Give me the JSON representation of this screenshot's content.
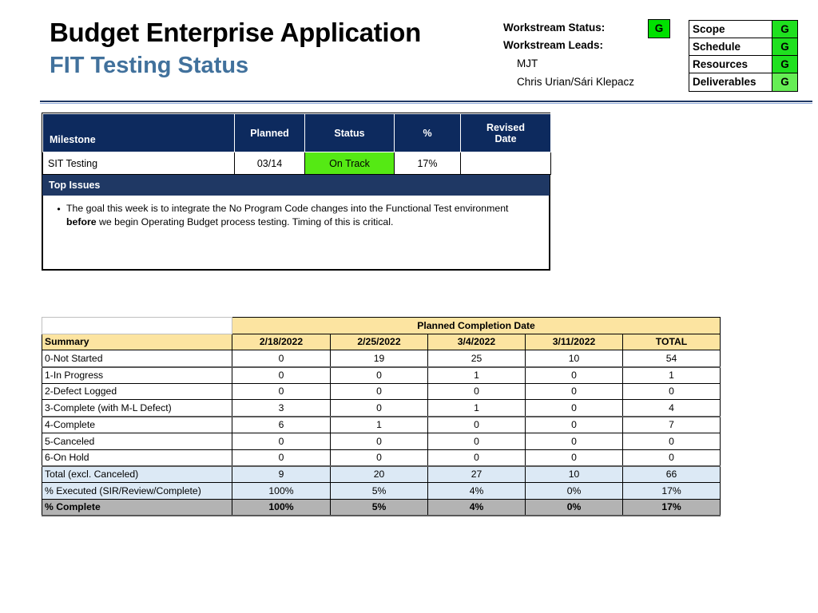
{
  "header": {
    "main_title": "Budget Enterprise Application",
    "sub_title": "FIT Testing Status",
    "workstream_status_label": "Workstream Status:",
    "workstream_status_value": "G",
    "workstream_leads_label": "Workstream Leads:",
    "lead_1": "MJT",
    "lead_2": "Chris Urian/Sári Klepacz",
    "accent_color": "#41719C",
    "status_green": "#00E000"
  },
  "rag": {
    "rows": [
      {
        "label": "Scope",
        "value": "G",
        "color": "#1FE01F"
      },
      {
        "label": "Schedule",
        "value": "G",
        "color": "#1FE01F"
      },
      {
        "label": "Resources",
        "value": "G",
        "color": "#1FE01F"
      },
      {
        "label": "Deliverables",
        "value": "G",
        "color": "#66EE55"
      }
    ]
  },
  "milestone": {
    "headers": [
      "Milestone",
      "Planned",
      "Status",
      "%",
      "Revised Date"
    ],
    "header_revised_line1": "Revised",
    "header_revised_line2": "Date",
    "rows": [
      {
        "milestone": "SIT Testing",
        "planned": "03/14",
        "status": "On Track",
        "percent": "17%",
        "revised_date": "",
        "status_color": "#55E914"
      }
    ],
    "top_issues_title": "Top Issues",
    "issues": [
      {
        "bullet": "•",
        "text_before": "The goal this week is to integrate the No Program Code changes into the Functional Test environment ",
        "text_bold": "before",
        "text_after": " we begin Operating Budget process testing.  Timing of this is critical."
      }
    ]
  },
  "summary": {
    "group_header": "Planned Completion Date",
    "row_label_header": "Summary",
    "columns": [
      "2/18/2022",
      "2/25/2022",
      "3/4/2022",
      "3/11/2022",
      "TOTAL"
    ],
    "rows": [
      {
        "label": "0-Not Started",
        "values": [
          "0",
          "19",
          "25",
          "10",
          "54"
        ],
        "style": "row-white"
      },
      {
        "label": "1-In Progress",
        "values": [
          "0",
          "0",
          "1",
          "0",
          "1"
        ],
        "style": "row-white"
      },
      {
        "label": "2-Defect Logged",
        "values": [
          "0",
          "0",
          "0",
          "0",
          "0"
        ],
        "style": "row-white"
      },
      {
        "label": "3-Complete (with M-L Defect)",
        "values": [
          "3",
          "0",
          "1",
          "0",
          "4"
        ],
        "style": "row-white"
      },
      {
        "label": "4-Complete",
        "values": [
          "6",
          "1",
          "0",
          "0",
          "7"
        ],
        "style": "row-white"
      },
      {
        "label": "5-Canceled",
        "values": [
          "0",
          "0",
          "0",
          "0",
          "0"
        ],
        "style": "row-white"
      },
      {
        "label": "6-On Hold",
        "values": [
          "0",
          "0",
          "0",
          "0",
          "0"
        ],
        "style": "row-white"
      },
      {
        "label": "Total (excl. Canceled)",
        "values": [
          "9",
          "20",
          "27",
          "10",
          "66"
        ],
        "style": "row-blue"
      },
      {
        "label": "% Executed (SIR/Review/Complete)",
        "values": [
          "100%",
          "5%",
          "4%",
          "0%",
          "17%"
        ],
        "style": "row-blue"
      },
      {
        "label": "% Complete",
        "values": [
          "100%",
          "5%",
          "4%",
          "0%",
          "17%"
        ],
        "style": "row-gray"
      }
    ],
    "header_color": "#FCE4A1",
    "total_row_color": "#DCE9F5",
    "complete_row_color": "#B3B3B3"
  }
}
